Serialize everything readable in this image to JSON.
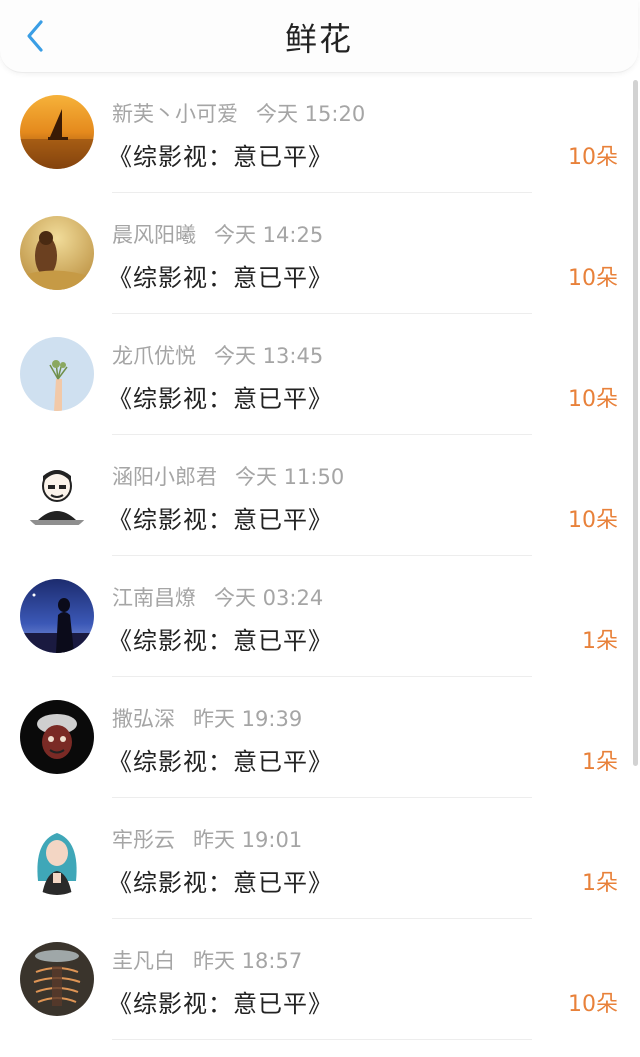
{
  "header": {
    "title": "鲜花",
    "back_icon": "chevron-left-icon",
    "accent": "#3a9ee5"
  },
  "colors": {
    "amount": "#e8813a",
    "meta": "#a5a5a5"
  },
  "items": [
    {
      "name": "新芙丶小可爱",
      "time": "今天 15:20",
      "work": "《综影视：意已平》",
      "amount": "10朵",
      "avatar": "sunset-sailboat"
    },
    {
      "name": "晨风阳曦",
      "time": "今天 14:25",
      "work": "《综影视：意已平》",
      "amount": "10朵",
      "avatar": "girl-in-wheat-field"
    },
    {
      "name": "龙爪优悦",
      "time": "今天 13:45",
      "work": "《综影视：意已平》",
      "amount": "10朵",
      "avatar": "hand-holding-plant"
    },
    {
      "name": "涵阳小郎君",
      "time": "今天 11:50",
      "work": "《综影视：意已平》",
      "amount": "10朵",
      "avatar": "cartoon-man"
    },
    {
      "name": "江南昌燎",
      "time": "今天 03:24",
      "work": "《综影视：意已平》",
      "amount": "1朵",
      "avatar": "silhouette-night"
    },
    {
      "name": "撒弘深",
      "time": "昨天 19:39",
      "work": "《综影视：意已平》",
      "amount": "1朵",
      "avatar": "masked-face-dark"
    },
    {
      "name": "牢彤云",
      "time": "昨天 19:01",
      "work": "《综影视：意已平》",
      "amount": "1朵",
      "avatar": "anime-girl-blue-hair"
    },
    {
      "name": "圭凡白",
      "time": "昨天 18:57",
      "work": "《综影视：意已平》",
      "amount": "10朵",
      "avatar": "light-painting"
    }
  ]
}
